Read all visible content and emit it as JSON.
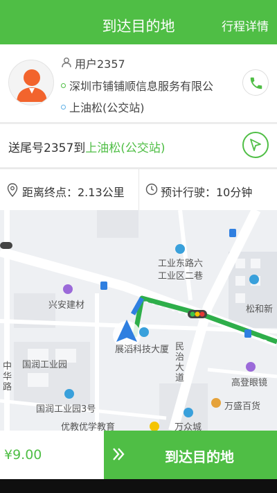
{
  "header": {
    "title": "到达目的地",
    "detail_link": "行程详情"
  },
  "passenger": {
    "name": "用户2357",
    "start": "深圳市铺铺顺信息服务有限公",
    "end": "上油松(公交站)"
  },
  "route": {
    "prefix": "送尾号2357到",
    "destination": "上油松(公交站)"
  },
  "info": {
    "distance": "距离终点：2.13公里",
    "duration": "预计行驶：10分钟"
  },
  "map": {
    "labels": {
      "gongye_east": "工业东路六",
      "gongye_zone": "工业区二巷",
      "xingan": "兴安建材",
      "songhe": "松和新",
      "zhanyun": "展滔科技大厦",
      "minzhi": "民治大道",
      "guorun": "国润工业园",
      "zhonghua": "中华路",
      "guorun3": "国润工业园3号",
      "gaoteng": "高登眼镜",
      "wansheng": "万盛百货",
      "youjiao": "优教优学教育",
      "wanzhong": "万众城"
    }
  },
  "bottom": {
    "price": "¥9.00",
    "arrive_button": "到达目的地"
  },
  "colors": {
    "brand_green": "#4fbe45",
    "route_blue": "#2f7fe0",
    "traffic_green": "#2eae4a"
  },
  "icons": [
    "phone-icon",
    "navigate-icon",
    "location-pin-icon",
    "clock-icon",
    "person-icon",
    "chevron-right-icon"
  ]
}
